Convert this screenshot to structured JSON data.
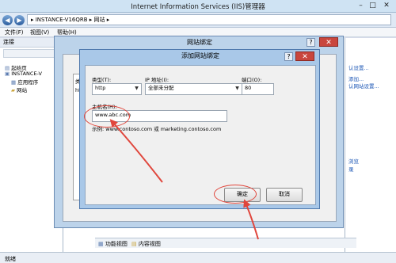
{
  "window": {
    "title": "Internet Information Services (IIS)管理器",
    "minimize": "–",
    "maximize": "□",
    "close": "✕"
  },
  "address": {
    "back": "◀",
    "forward": "▶",
    "path": "▸ INSTANCE-V16QRB ▸ 网站 ▸"
  },
  "menu": {
    "file": "文件(F)",
    "view": "视图(V)",
    "help": "帮助(H)"
  },
  "left_pane": {
    "header": "连接",
    "tree": [
      "起始页",
      "INSTANCE-V",
      "应用程序",
      "网站"
    ]
  },
  "bindings_dialog": {
    "title": "网站绑定",
    "help": "?",
    "close": "✕",
    "list_header": "类型",
    "list_value": "http"
  },
  "add_binding_dialog": {
    "title": "添加网站绑定",
    "help": "?",
    "close": "✕",
    "type_label": "类型(T):",
    "type_value": "http",
    "ip_label": "IP 地址(I):",
    "ip_value": "全部未分配",
    "port_label": "端口(O):",
    "port_value": "80",
    "host_label": "主机名(H):",
    "host_value": "www.abc.com",
    "example": "示例: www.contoso.com 或 marketing.contoso.com",
    "ok": "确定",
    "cancel": "取消"
  },
  "right_pane": {
    "links": [
      "认设置...",
      "",
      "添加...",
      "认网站设置...",
      "",
      "",
      "",
      "",
      "浏览",
      "录"
    ]
  },
  "bottom_tabs": {
    "features": "功能视图",
    "content": "内容视图"
  },
  "statusbar": {
    "text": "就绪"
  },
  "colors": {
    "annotation_red": "#e0463c",
    "dialog_frame": "#a9c8e8",
    "title_bar": "#cfe3f3"
  }
}
